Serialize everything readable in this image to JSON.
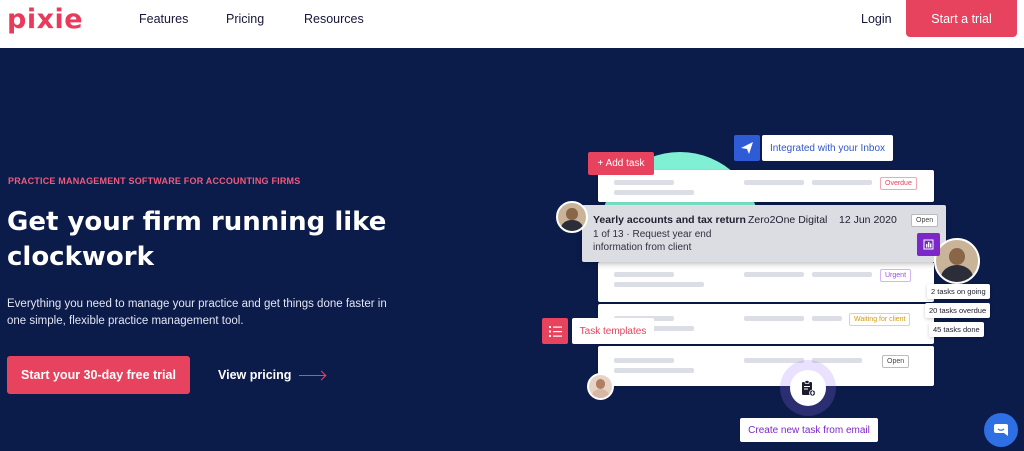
{
  "header": {
    "logo": "pixie",
    "nav": [
      "Features",
      "Pricing",
      "Resources"
    ],
    "login_label": "Login",
    "trial_label": "Start a trial"
  },
  "hero": {
    "eyebrow": "PRACTICE MANAGEMENT SOFTWARE FOR ACCOUNTING FIRMS",
    "headline": "Get your firm running like clockwork",
    "subtext": "Everything you need to manage your practice and get things done faster in one simple, flexible practice management tool.",
    "cta_label": "Start your 30-day free trial",
    "secondary_label": "View pricing"
  },
  "illustration": {
    "add_task_label": "+ Add task",
    "inbox_label": "Integrated with your Inbox",
    "templates_label": "Task templates",
    "email_label": "Create new task from email",
    "active_task": {
      "title": "Yearly accounts and tax return",
      "client": "Zero2One Digital",
      "date": "12 Jun 2020",
      "progress": "1 of 13 · Request year end information from client",
      "status": "Open"
    },
    "tags": {
      "overdue": "Overdue",
      "urgent": "Urgent",
      "waiting": "Waiting for client",
      "open": "Open"
    },
    "stats": [
      "2 tasks on going",
      "20 tasks overdue",
      "45 tasks done"
    ]
  },
  "colors": {
    "brand": "#e8435e",
    "hero_bg": "#0b1b4a",
    "accent_blue": "#2f5bd6",
    "accent_purple": "#7c28c9",
    "accent_mint": "#7ff0d3"
  }
}
